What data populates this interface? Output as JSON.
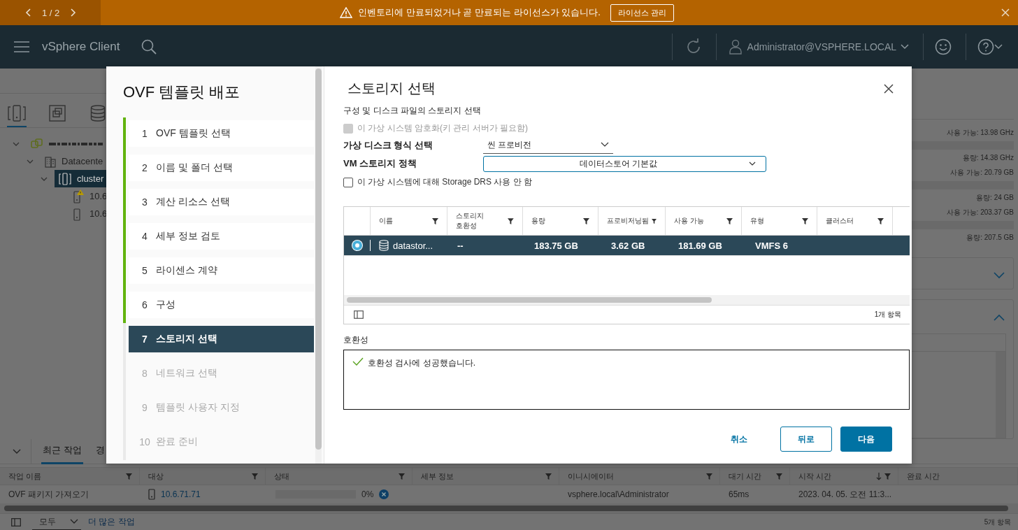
{
  "banner": {
    "pager": "1 / 2",
    "message": "인벤토리에 만료되었거나 곧 만료되는 라이선스가 있습니다.",
    "action": "라이선스 관리"
  },
  "header": {
    "app_name": "vSphere Client",
    "user": "Administrator@VSPHERE.LOCAL"
  },
  "navigator": {
    "tabs": [
      {
        "kind": "hosts",
        "selected": true
      },
      {
        "kind": "vms",
        "selected": false
      },
      {
        "kind": "storage",
        "selected": false
      }
    ],
    "tree": [
      {
        "kind": "vcenter",
        "expanded": true,
        "selected": false,
        "children": [
          {
            "kind": "datacenter",
            "label": "Datacente",
            "expanded": true,
            "selected": false,
            "children": [
              {
                "kind": "cluster",
                "label": "cluster",
                "expanded": true,
                "selected": true,
                "children": [
                  {
                    "kind": "host",
                    "label": "10.6",
                    "warning": true,
                    "selected": false
                  },
                  {
                    "kind": "host",
                    "label": "10.6",
                    "warning": false,
                    "selected": false
                  }
                ]
              }
            ]
          }
        ]
      }
    ]
  },
  "resources": [
    {
      "available": "사용 가능: 13.98 GHz",
      "capacity": "용량: 14.38 GHz"
    },
    {
      "available": "사용 가능: 20.79 GB",
      "capacity": "용량: 24 GB"
    },
    {
      "available": "사용 가능: 203.37 GB",
      "capacity": "용량: 207.5 GB"
    }
  ],
  "panels": [
    {
      "expanded": false
    },
    {
      "expanded": true
    }
  ],
  "wizard": {
    "title": "OVF 템플릿 배포",
    "steps": [
      {
        "number": "1",
        "label": "OVF 템플릿 선택",
        "completed": true,
        "selected": false
      },
      {
        "number": "2",
        "label": "이름 및 폴더 선택",
        "completed": true,
        "selected": false
      },
      {
        "number": "3",
        "label": "계산 리소스 선택",
        "completed": true,
        "selected": false
      },
      {
        "number": "4",
        "label": "세부 정보 검토",
        "completed": true,
        "selected": false
      },
      {
        "number": "5",
        "label": "라이센스 계약",
        "completed": true,
        "selected": false
      },
      {
        "number": "6",
        "label": "구성",
        "completed": true,
        "selected": false
      },
      {
        "number": "7",
        "label": "스토리지 선택",
        "completed": false,
        "selected": true
      },
      {
        "number": "8",
        "label": "네트워크 선택",
        "completed": false,
        "selected": false
      },
      {
        "number": "9",
        "label": "템플릿 사용자 지정",
        "completed": false,
        "selected": false
      },
      {
        "number": "10",
        "label": "완료 준비",
        "completed": false,
        "selected": false
      }
    ],
    "page_title": "스토리지 선택",
    "subtitle": "구성 및 디스크 파일의 스토리지 선택",
    "encrypt": {
      "label": "이 가상 시스템 암호화(키 관리 서버가 필요함)",
      "checked": false,
      "disabled": true
    },
    "disk_format": {
      "label": "가상 디스크 형식 선택",
      "value": "씬 프로비전"
    },
    "storage_policy": {
      "label": "VM 스토리지 정책",
      "value": "데이터스토어 기본값"
    },
    "drs": {
      "label": "이 가상 시스템에 대해 Storage DRS 사용 안 함",
      "checked": false,
      "disabled": false
    },
    "table": {
      "columns": [
        "이름",
        "스토리지 호환성",
        "용량",
        "프로비저닝됨",
        "사용 가능",
        "유형",
        "클러스터"
      ],
      "rows": [
        {
          "selected": true,
          "cells": [
            "datastor...",
            "--",
            "183.75 GB",
            "3.62 GB",
            "181.69 GB",
            "VMFS 6",
            null
          ]
        }
      ],
      "footer": "1개 항목"
    },
    "compatibility": {
      "label": "호환성",
      "message": "호환성 검사에 성공했습니다.",
      "ok": true
    },
    "buttons": [
      {
        "kind": "link",
        "label": "취소"
      },
      {
        "kind": "outline",
        "label": "뒤로"
      },
      {
        "kind": "primary",
        "label": "다음"
      }
    ]
  },
  "tasks": {
    "tabs": [
      {
        "label": "최근 작업",
        "selected": true
      },
      {
        "label": "경",
        "selected": false
      }
    ],
    "columns": [
      {
        "label": "작업 이름",
        "sorted": false
      },
      {
        "label": "대상",
        "sorted": false
      },
      {
        "label": "상태",
        "sorted": false
      },
      {
        "label": "세부 정보",
        "sorted": false
      },
      {
        "label": "이니시에이터",
        "sorted": false
      },
      {
        "label": "대기 시간",
        "sorted": false
      },
      {
        "label": "시작 시간",
        "sorted": true
      },
      {
        "label": "완료 시간",
        "sorted": false
      }
    ],
    "rows": [
      {
        "name": "OVF 패키지 가져오기",
        "target": "10.6.71.71",
        "level": 0,
        "status": "0%",
        "initiator": "vsphere.local\\Administrator",
        "queued": "65ms",
        "start": "2023. 04. 05. 오전 11:3..."
      }
    ],
    "filter": "모두",
    "more": "더 많은 작업",
    "count": "5개 항목"
  }
}
